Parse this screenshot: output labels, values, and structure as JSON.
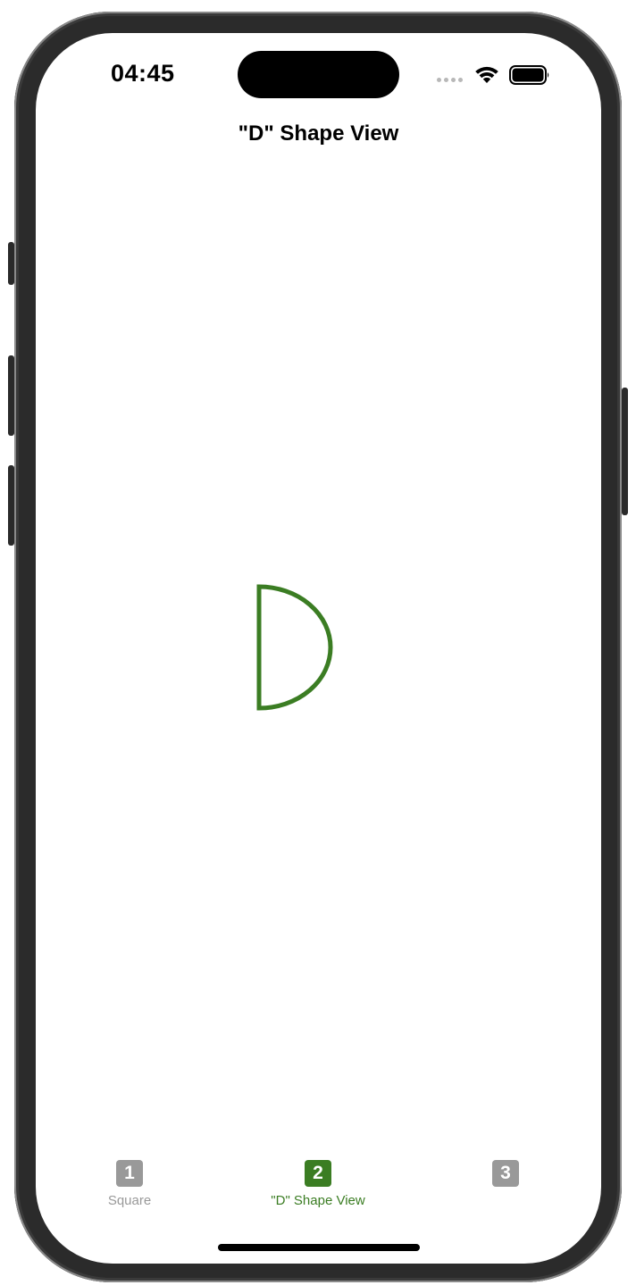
{
  "status_bar": {
    "time": "04:45",
    "icons": [
      "cellular-signal-icon",
      "wifi-icon",
      "battery-icon"
    ]
  },
  "navigation": {
    "title": "\"D\" Shape View"
  },
  "shape": {
    "name": "D",
    "stroke_color": "#3b7d23"
  },
  "tab_bar": {
    "active_color": "#3b7d23",
    "inactive_color": "#999999",
    "items": [
      {
        "icon_text": "1",
        "label": "Square",
        "selected": false
      },
      {
        "icon_text": "2",
        "label": "\"D\" Shape View",
        "selected": true
      },
      {
        "icon_text": "3",
        "label": "",
        "selected": false
      }
    ]
  }
}
